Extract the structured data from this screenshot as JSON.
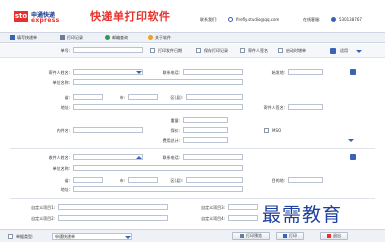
{
  "header": {
    "logo_mark": "sto",
    "logo_cn": "申通快递",
    "logo_en": "express",
    "app_title": "快递单打印软件",
    "contact_label": "联系我们:",
    "email": "firefly.studio@qq.com",
    "qq_label": "在线客服:",
    "qq_number": "530138767"
  },
  "menu": {
    "items": [
      {
        "label": "填写快递单",
        "icon": "edit-icon"
      },
      {
        "label": "打印记录",
        "icon": "printer-icon"
      },
      {
        "label": "邮编查询",
        "icon": "search-icon"
      },
      {
        "label": "关于软件",
        "icon": "info-icon"
      }
    ]
  },
  "toolbar": {
    "order_no_label": "单号:",
    "order_no_value": "",
    "print_date_label": "打印发件日期",
    "save_record_label": "保存打印记录",
    "signature_label": "寄件人签名",
    "auto_increment_label": "启动时增单",
    "fit_label": "适用"
  },
  "sender": {
    "name_label": "寄件人姓名:",
    "name_value": "",
    "phone_label": "联系电话:",
    "phone_value": "",
    "post_label": "始发地:",
    "post_value": "",
    "company_label": "单位名称:",
    "company_value": "",
    "province_label": "省:",
    "city_label": "市:",
    "district_label": "区(县):",
    "address_label": "地址:",
    "signature_label": "寄件人签名:"
  },
  "parcel": {
    "weight_label": "重量:",
    "content_label": "内件名:",
    "declared_label": "保价:",
    "fee_label": "费用总计:",
    "mso_label": "MSO"
  },
  "receiver": {
    "name_label": "收件人姓名:",
    "name_value": "",
    "phone_label": "联系电话:",
    "phone_value": "",
    "company_label": "单位名称:",
    "province_label": "省:",
    "city_label": "市:",
    "district_label": "区(县):",
    "destination_label": "目的地:",
    "address_label": "地址:"
  },
  "custom": {
    "item1_label": "自定义项目1:",
    "item2_label": "自定义项目2:",
    "item3_label": "自定义项目3:",
    "item4_label": "自定义项目4:"
  },
  "footer": {
    "type_label": "单据类型:",
    "type_value": "申通快递单",
    "preview_label": "打印预览",
    "print_label": "打印",
    "exit_label": "退出"
  },
  "watermark": "最需教育",
  "colors": {
    "brand_red": "#e8312a",
    "brand_blue": "#1a3a8a",
    "accent": "#3a63b5"
  }
}
